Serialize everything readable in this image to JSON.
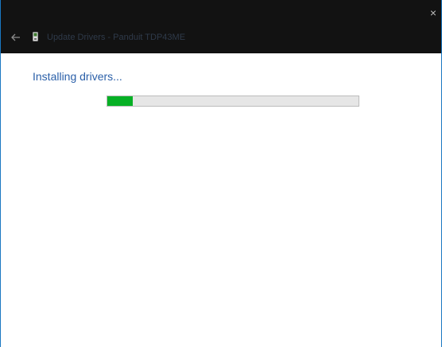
{
  "window": {
    "title": "Update Drivers - Panduit TDP43ME",
    "close_symbol": "×",
    "back_icon": "back-arrow-icon",
    "app_icon": "device-icon"
  },
  "main": {
    "heading": "Installing drivers...",
    "progress": {
      "fraction": 0.1,
      "fill_color": "#06b025",
      "track_color": "#e6e6e6"
    }
  },
  "colors": {
    "titlebar": "#121212",
    "heading": "#2a5fa8",
    "window_border": "#1a78c2"
  }
}
